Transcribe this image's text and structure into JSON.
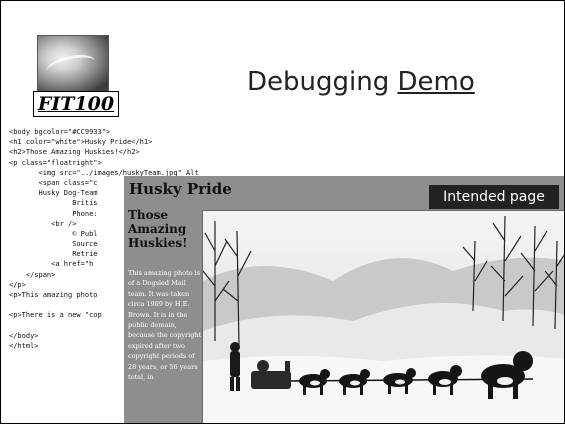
{
  "slide": {
    "logo_text": "FIT100",
    "title_prefix": "Debugging",
    "title_link": "Demo"
  },
  "code_lines": [
    "<body bgcolor=\"#CC9933\">",
    "<h1 color=\"white\">Husky Pride</h1>",
    "<h2>Those Amazing Huskies!</h2>",
    "<p class=\"floatright\">",
    "       <img src=\"../images/huskyTeam.jpg\" Alt",
    "       <span class=\"c",
    "       Husky Dog-Team",
    "               Britis",
    "               Phone:",
    "          <br />",
    "               © Publ",
    "               Source",
    "               Retrie",
    "          <a href=\"h",
    "    </span>",
    "</p>",
    "<p>This amazing photo",
    "",
    "<p>There is a new \"cop",
    "",
    "</body>",
    "</html>"
  ],
  "page_screenshot": {
    "h1": "Husky Pride",
    "h2": "Those Amazing Huskies!",
    "paragraph": "This amazing photo is of a Dogsled Mail team. It was taken circa 1909 by H.E. Brown. It is in the public domain, because the copyright expired after two copyright periods of 28 years, or 56 years total, in",
    "label": "Intended page"
  },
  "colors": {
    "page_bg": "#8e8e8e",
    "label_bg": "#222222",
    "label_text": "#ffffff"
  }
}
